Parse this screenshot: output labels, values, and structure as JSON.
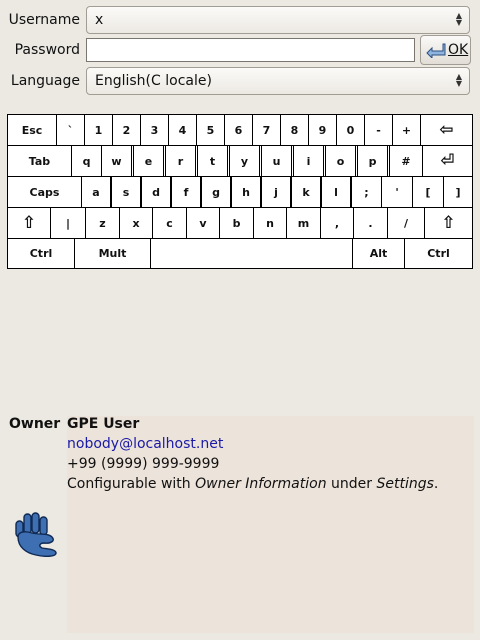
{
  "login": {
    "username_label": "Username",
    "username_value": "x",
    "password_label": "Password",
    "password_value": "",
    "ok_label": "OK",
    "language_label": "Language",
    "language_value": "English(C locale)"
  },
  "keyboard": {
    "row1": [
      "Esc",
      "`",
      "1",
      "2",
      "3",
      "4",
      "5",
      "6",
      "7",
      "8",
      "9",
      "0",
      "-",
      "+",
      "⇦"
    ],
    "row2": [
      "Tab",
      "q",
      "w",
      "e",
      "r",
      "t",
      "y",
      "u",
      "i",
      "o",
      "p",
      "#",
      "⏎"
    ],
    "row3": [
      "Caps",
      "a",
      "s",
      "d",
      "f",
      "g",
      "h",
      "j",
      "k",
      "l",
      ";",
      "'",
      "[",
      "]"
    ],
    "row4": [
      "⇧",
      "|",
      "z",
      "x",
      "c",
      "v",
      "b",
      "n",
      "m",
      ",",
      ".",
      "/",
      "⇧"
    ],
    "row5": [
      "Ctrl",
      "Mult",
      "",
      "Alt",
      "Ctrl"
    ]
  },
  "owner": {
    "label": "Owner",
    "name": "GPE User",
    "email": "nobody@localhost.net",
    "phone": "+99 (9999) 999-9999",
    "info_prefix": "Configurable with ",
    "info_em1": "Owner Information",
    "info_mid": " under ",
    "info_em2": "Settings",
    "info_suffix": "."
  },
  "icons": {
    "ok": "enter-arrow-icon",
    "logo": "gpe-paw-logo"
  }
}
